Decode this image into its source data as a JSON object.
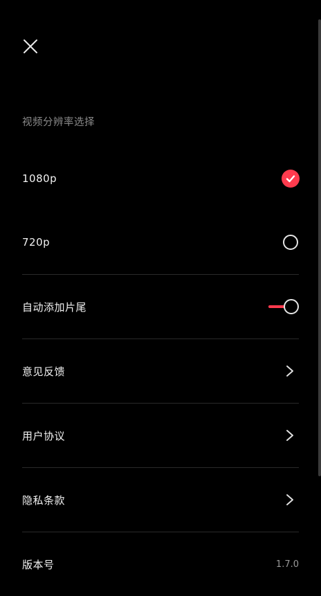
{
  "header": {
    "close_icon": "close-icon"
  },
  "section": {
    "title": "视频分辨率选择"
  },
  "resolution": {
    "options": [
      {
        "label": "1080p",
        "selected": true
      },
      {
        "label": "720p",
        "selected": false
      }
    ]
  },
  "settings": {
    "auto_outro_label": "自动添加片尾",
    "auto_outro_on": true,
    "feedback_label": "意见反馈",
    "user_agreement_label": "用户协议",
    "privacy_label": "隐私条款",
    "version_label": "版本号",
    "version_value": "1.7.0"
  },
  "colors": {
    "accent": "#ff3b4e",
    "background": "#000000",
    "text": "#f2f2f2",
    "muted": "#8a8a8a",
    "divider": "#2a2a2a"
  }
}
